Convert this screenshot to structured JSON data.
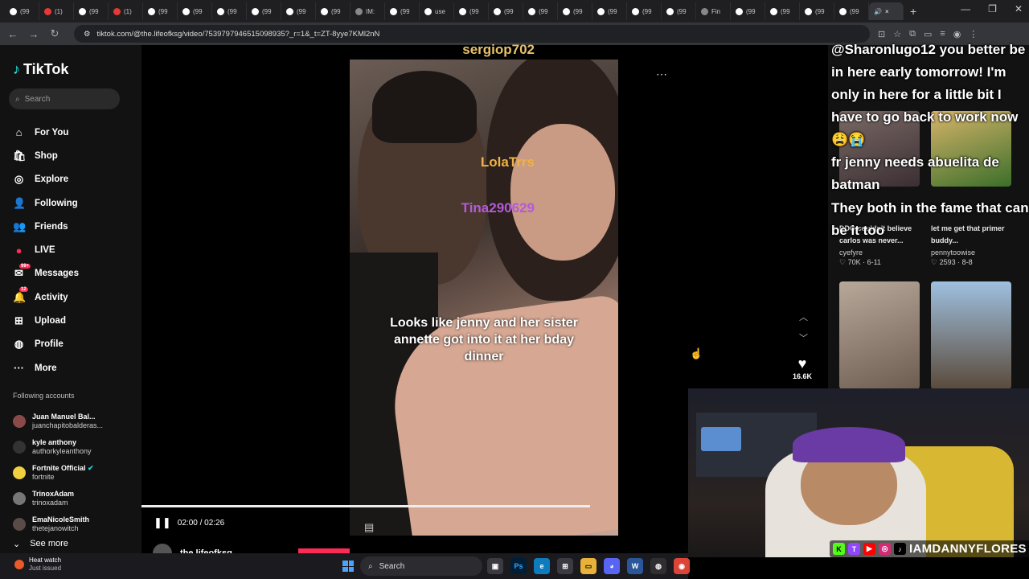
{
  "browser": {
    "tabs": [
      "(99",
      "(1)",
      "(99",
      "(1)",
      "(99",
      "(99",
      "(99",
      "(99",
      "(99",
      "(99",
      "IM:",
      "(99",
      "use",
      "(99",
      "(99",
      "(99",
      "(99",
      "(99",
      "(99",
      "(99",
      "Fin",
      "(99",
      "(99",
      "(99",
      "(99"
    ],
    "active_tab_close": "×",
    "new_tab": "+",
    "url": "tiktok.com/@the.lifeofksg/video/7539797946515098935?_r=1&_t=ZT-8yye7KMl2nN"
  },
  "sidebar": {
    "brand": "TikTok",
    "search_placeholder": "Search",
    "nav": [
      {
        "label": "For You",
        "icon": "home-icon"
      },
      {
        "label": "Shop",
        "icon": "shop-icon"
      },
      {
        "label": "Explore",
        "icon": "compass-icon"
      },
      {
        "label": "Following",
        "icon": "following-icon"
      },
      {
        "label": "Friends",
        "icon": "friends-icon"
      },
      {
        "label": "LIVE",
        "icon": "live-icon"
      },
      {
        "label": "Messages",
        "icon": "messages-icon",
        "badge": "99+"
      },
      {
        "label": "Activity",
        "icon": "activity-icon",
        "badge": "12"
      },
      {
        "label": "Upload",
        "icon": "upload-icon"
      },
      {
        "label": "Profile",
        "icon": "profile-icon"
      },
      {
        "label": "More",
        "icon": "more-icon"
      }
    ],
    "following_title": "Following accounts",
    "following": [
      {
        "name": "Juan Manuel Bal...",
        "handle": "juanchapitobalderas..."
      },
      {
        "name": "kyle anthony",
        "handle": "authorkyleanthony"
      },
      {
        "name": "Fortnite Official",
        "handle": "fortnite"
      },
      {
        "name": "TrinoxAdam",
        "handle": "trinoxadam"
      },
      {
        "name": "EmaNicoleSmith",
        "handle": "thetejanowitch"
      }
    ],
    "see_more": "See more"
  },
  "video": {
    "caption": "Looks like jenny and her sister annette got into it at her bday dinner",
    "time": "02:00 / 02:26",
    "progress": 0.82,
    "likes": "16.6K",
    "author": "the.lifeofksg"
  },
  "related": [
    {
      "title": "DDG couldn't believe carlos was never...",
      "user": "cyefyre",
      "stats": "♡ 70K · 6-11"
    },
    {
      "title": "let me get that primer buddy...",
      "user": "pennytoowise",
      "stats": "♡ 2593 · 8-8"
    }
  ],
  "chat": [
    {
      "name": "sergiop702",
      "color": "#e8c16a",
      "message": "@Sharonlugo12 you better be in here early tomorrow! I'm only in here for a little bit I have to go back to work now 😩😭"
    },
    {
      "name": "LolaTrrs",
      "color": "#f0b343",
      "message": "fr jenny needs abuelita de batman"
    },
    {
      "name": "Tina290629",
      "color": "#b45ad8",
      "message": "They both in the fame that can be it too"
    }
  ],
  "stream_handle": "IAMDANNYFLORES",
  "taskbar": {
    "weather_title": "Heat watch",
    "weather_sub": "Just issued",
    "search_label": "Search"
  }
}
